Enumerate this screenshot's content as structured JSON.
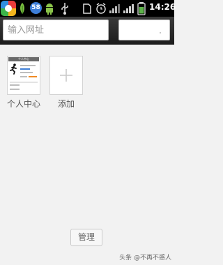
{
  "status_bar": {
    "badge": "58",
    "time": "14:26",
    "icons": [
      "app-logo",
      "leaf-notification",
      "badge-58",
      "android-notification",
      "usb",
      "sd-card",
      "alarm",
      "signal",
      "wifi",
      "battery"
    ]
  },
  "top_bar": {
    "url_placeholder": "输入网址",
    "url_value": ""
  },
  "tiles": [
    {
      "label": "个人中心",
      "thumbnail_title": "个人中心",
      "thumbnail_icon": "runner"
    },
    {
      "label": "添加",
      "icon": "plus"
    }
  ],
  "footer": {
    "manage_label": "管理"
  },
  "watermark": "头条 @不再不惑人",
  "colors": {
    "status_bar": "#000000",
    "top_bar": "#2b2b2b",
    "background": "#f2f2f2"
  }
}
